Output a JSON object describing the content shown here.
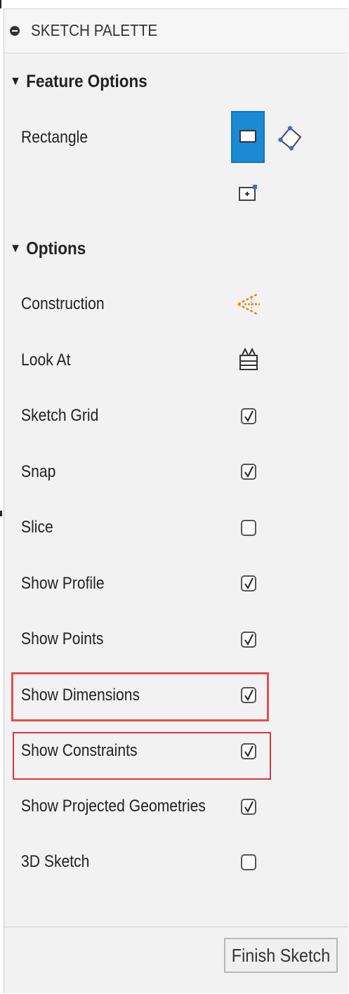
{
  "palette": {
    "title": "SKETCH PALETTE",
    "feature_options": {
      "heading": "Feature Options",
      "rectangle_label": "Rectangle",
      "rectangle_icons": [
        "two-point-rectangle-icon",
        "three-point-rectangle-icon",
        "center-rectangle-icon"
      ],
      "selected": "two-point-rectangle-icon"
    },
    "options": {
      "heading": "Options",
      "construction_label": "Construction",
      "construction_icon": "construction-icon",
      "look_at_label": "Look At",
      "look_at_icon": "look-at-icon",
      "rows": [
        {
          "label": "Sketch Grid",
          "checked": true
        },
        {
          "label": "Snap",
          "checked": true
        },
        {
          "label": "Slice",
          "checked": false
        },
        {
          "label": "Show Profile",
          "checked": true
        },
        {
          "label": "Show Points",
          "checked": true
        },
        {
          "label": "Show Dimensions",
          "checked": true
        },
        {
          "label": "Show Constraints",
          "checked": true
        },
        {
          "label": "Show Projected Geometries",
          "checked": true
        },
        {
          "label": "3D Sketch",
          "checked": false
        }
      ]
    },
    "finish_button": "Finish Sketch",
    "colors": {
      "selected_button": "#1a8ad4",
      "highlight": "#e05050"
    }
  }
}
